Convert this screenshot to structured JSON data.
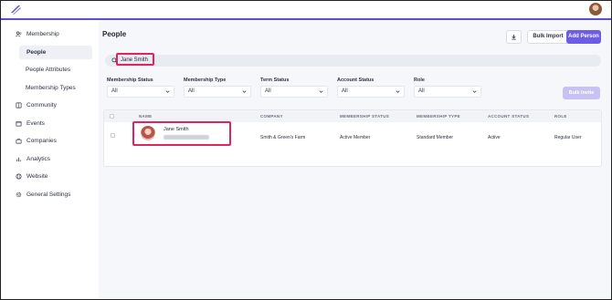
{
  "sidebar": {
    "items": [
      {
        "label": "Membership",
        "icon": "users-icon"
      },
      {
        "label": "People",
        "active": true
      },
      {
        "label": "People Attributes"
      },
      {
        "label": "Membership Types"
      },
      {
        "label": "Community",
        "icon": "book-icon"
      },
      {
        "label": "Events",
        "icon": "calendar-icon"
      },
      {
        "label": "Companies",
        "icon": "briefcase-icon"
      },
      {
        "label": "Analytics",
        "icon": "chart-icon"
      },
      {
        "label": "Website",
        "icon": "globe-icon"
      },
      {
        "label": "General Settings",
        "icon": "gear-icon"
      }
    ]
  },
  "header": {
    "title": "People",
    "bulk_import": "Bulk Import",
    "add_person": "Add Person"
  },
  "search": {
    "value": "Jane Smith"
  },
  "filters": [
    {
      "label": "Membership Status",
      "value": "All"
    },
    {
      "label": "Membership Type",
      "value": "All"
    },
    {
      "label": "Term Status",
      "value": "All"
    },
    {
      "label": "Account Status",
      "value": "All"
    },
    {
      "label": "Role",
      "value": "All"
    }
  ],
  "bulk_invite": "Bulk Invite",
  "table": {
    "columns": [
      "NAME",
      "COMPANY",
      "MEMBERSHIP STATUS",
      "MEMBERSHIP TYPE",
      "ACCOUNT STATUS",
      "ROLE"
    ],
    "rows": [
      {
        "name": "Jane Smith",
        "company": "Smith & Green's Farm",
        "membership_status": "Active Member",
        "membership_type": "Standard Member",
        "account_status": "Active",
        "role": "Regular User"
      }
    ]
  },
  "colors": {
    "accent": "#6d5ce8",
    "highlight": "#e0245e"
  }
}
